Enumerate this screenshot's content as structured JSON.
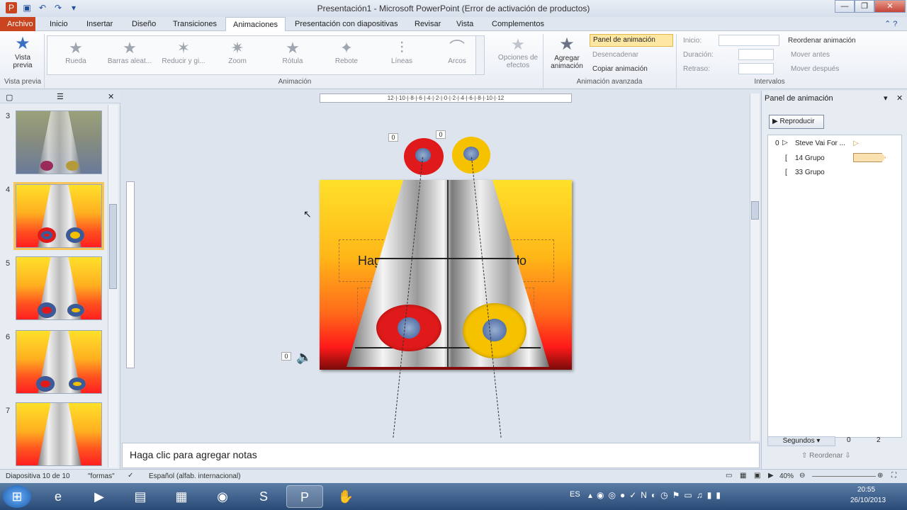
{
  "window": {
    "title": "Presentación1  -  Microsoft PowerPoint (Error de activación de productos)"
  },
  "tabs": [
    "Archivo",
    "Inicio",
    "Insertar",
    "Diseño",
    "Transiciones",
    "Animaciones",
    "Presentación con diapositivas",
    "Revisar",
    "Vista",
    "Complementos"
  ],
  "ribbon": {
    "preview_label": "Vista previa",
    "preview_group": "Vista previa",
    "effects": [
      "Rueda",
      "Barras aleat...",
      "Reducir y gi...",
      "Zoom",
      "Rótula",
      "Rebote",
      "Líneas",
      "Arcos"
    ],
    "effect_options": "Opciones de efectos",
    "animation_group": "Animación",
    "add_animation": "Agregar animación",
    "panel_btn": "Panel de animación",
    "trigger": "Desencadenar",
    "copy_anim": "Copiar animación",
    "advanced_group": "Animación avanzada",
    "start": "Inicio:",
    "duration": "Duración:",
    "delay": "Retraso:",
    "reorder": "Reordenar animación",
    "move_earlier": "Mover antes",
    "move_later": "Mover después",
    "timing_group": "Intervalos"
  },
  "thumbnails": [
    {
      "num": "3"
    },
    {
      "num": "4"
    },
    {
      "num": "5"
    },
    {
      "num": "6"
    },
    {
      "num": "7"
    }
  ],
  "slide": {
    "title_left": "Hag",
    "title_right": "ulo",
    "tag0": "0"
  },
  "rulers": {
    "h": "12·|·10·|·8·|·6·|·4·|·2·|·0·|·2·|·4·|·6·|·8·|·10·|·12"
  },
  "notes": "Haga clic para agregar notas",
  "anim_pane": {
    "title": "Panel de animación",
    "play": "Reproducir",
    "items": [
      {
        "num": "0",
        "label": "Steve Vai For ..."
      },
      {
        "num": "",
        "label": "14 Grupo"
      },
      {
        "num": "",
        "label": "33 Grupo"
      }
    ],
    "seconds": "Segundos",
    "scale_a": "0",
    "scale_b": "2",
    "reorder": "Reordenar"
  },
  "status": {
    "slide": "Diapositiva 10 de 10",
    "theme": "\"formas\"",
    "lang": "Español (alfab. internacional)",
    "zoom": "40%"
  },
  "taskbar": {
    "lang": "ES",
    "time": "20:55",
    "date": "26/10/2013"
  }
}
